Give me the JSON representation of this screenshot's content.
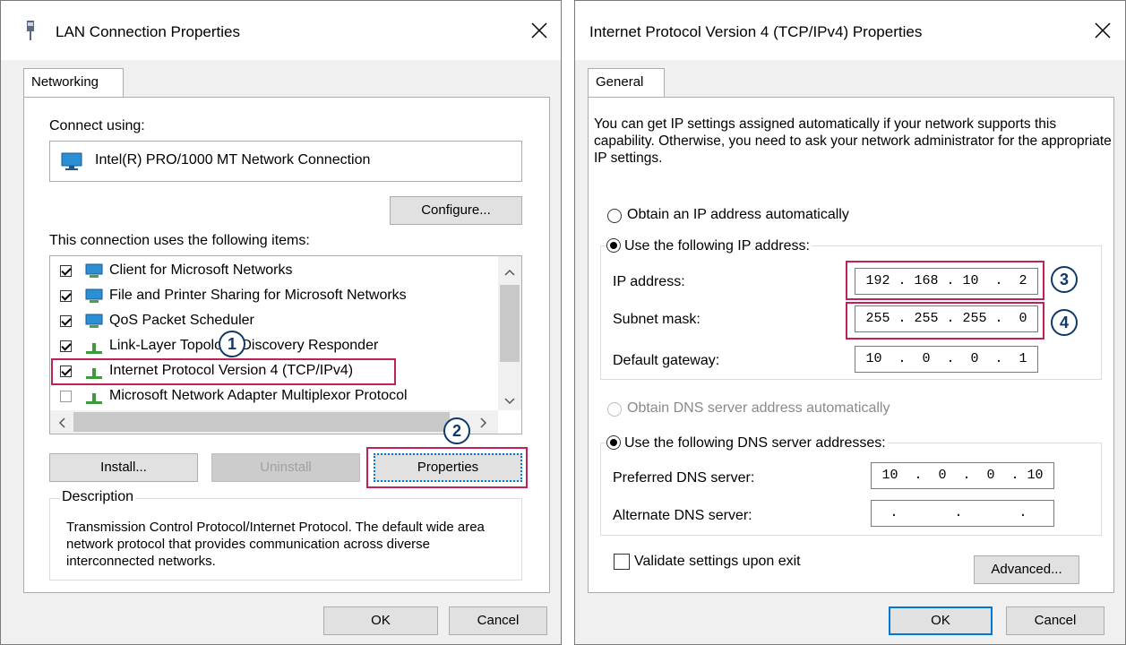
{
  "lan_dialog": {
    "title": "LAN Connection Properties",
    "tab": "Networking",
    "connect_using_label": "Connect using:",
    "adapter_name": "Intel(R) PRO/1000 MT Network Connection",
    "configure_button": "Configure...",
    "items_label": "This connection uses the following items:",
    "items": [
      {
        "label": "Client for Microsoft Networks",
        "checked": true,
        "icon": "network-client-icon"
      },
      {
        "label": "File and Printer Sharing for Microsoft Networks",
        "checked": true,
        "icon": "network-service-icon"
      },
      {
        "label": "QoS Packet Scheduler",
        "checked": true,
        "icon": "network-service-icon"
      },
      {
        "label": "Link-Layer Topology Discovery Responder",
        "checked": true,
        "icon": "protocol-icon"
      },
      {
        "label": "Internet Protocol Version 4 (TCP/IPv4)",
        "checked": true,
        "icon": "protocol-icon"
      },
      {
        "label": "Microsoft Network Adapter Multiplexor Protocol",
        "checked": false,
        "icon": "protocol-icon"
      }
    ],
    "install_button": "Install...",
    "uninstall_button": "Uninstall",
    "properties_button": "Properties",
    "description_legend": "Description",
    "description_text": "Transmission Control Protocol/Internet Protocol. The default wide area network protocol that provides communication across diverse interconnected networks.",
    "ok_button": "OK",
    "cancel_button": "Cancel"
  },
  "ipv4_dialog": {
    "title": "Internet Protocol Version 4 (TCP/IPv4) Properties",
    "tab": "General",
    "intro_text": "You can get IP settings assigned automatically if your network supports this capability. Otherwise, you need to ask your network administrator for the appropriate IP settings.",
    "obtain_ip_auto": "Obtain an IP address automatically",
    "use_following_ip": "Use the following IP address:",
    "ip_address_label": "IP address:",
    "ip_address_value": "192 . 168 . 10  .  2",
    "subnet_mask_label": "Subnet mask:",
    "subnet_mask_value": "255 . 255 . 255 .  0",
    "default_gateway_label": "Default gateway:",
    "default_gateway_value": "10  .  0  .  0  .  1",
    "obtain_dns_auto": "Obtain DNS server address automatically",
    "use_following_dns": "Use the following DNS server addresses:",
    "preferred_dns_label": "Preferred DNS server:",
    "preferred_dns_value": "10  .  0  .  0  . 10",
    "alternate_dns_label": "Alternate DNS server:",
    "alternate_dns_value": " .       .       .  ",
    "validate_label": "Validate settings upon exit",
    "advanced_button": "Advanced...",
    "ok_button": "OK",
    "cancel_button": "Cancel"
  },
  "markers": [
    "1",
    "2",
    "3",
    "4"
  ],
  "colors": {
    "highlight": "#c0215d",
    "marker": "#0e3a6a",
    "default_button": "#0078d7"
  }
}
